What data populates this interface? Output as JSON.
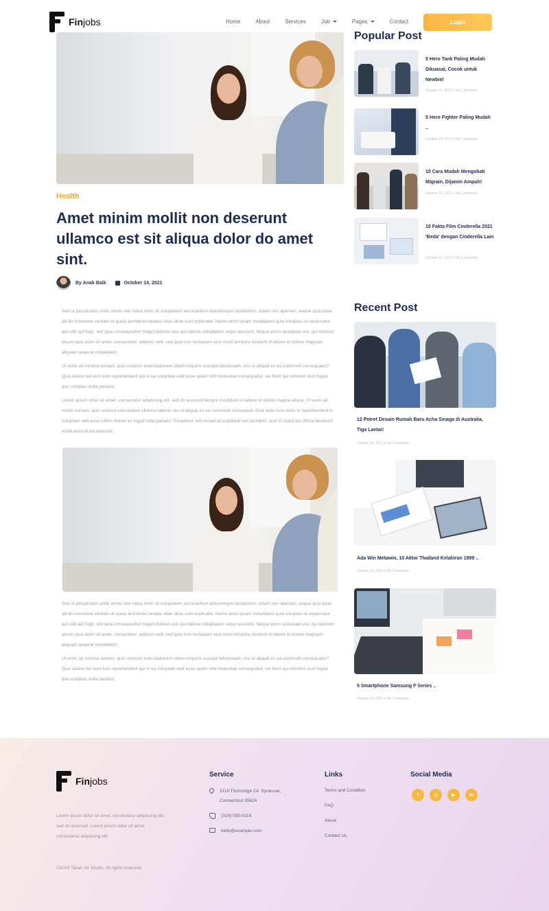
{
  "brand": {
    "name_bold": "Fin",
    "name_rest": "jobs"
  },
  "nav": {
    "items": [
      {
        "label": "Home",
        "dropdown": false
      },
      {
        "label": "About",
        "dropdown": false
      },
      {
        "label": "Services",
        "dropdown": false
      },
      {
        "label": "Job",
        "dropdown": true
      },
      {
        "label": "Pages",
        "dropdown": true
      },
      {
        "label": "Contact",
        "dropdown": false
      }
    ],
    "login_label": "Login"
  },
  "article": {
    "category": "Health",
    "title": "Amet minim mollit non deserunt ullamco est sit aliqua dolor do amet sint.",
    "author": "By Anak Baik",
    "date": "October 14, 2021",
    "paragraphs": [
      "Sed ut perspiciatis unde omnis iste natus error sit voluptatem accusantium doloremque laudantium, totam rem aperiam, eaque ipsa quae ab illo inventore veritatis et quasi architecto beatae vitae dicta sunt explicabo. Nemo enim ipsam voluptatem quia voluptas sit aspernatur aut odit aut fugit, sed quia consequuntur magni dolores eos qui ratione voluptatem sequi nesciunt. Neque porro quisquam est, qui dolorem ipsum quia dolor sit amet, consectetur, adipisci velit, sed quia non numquam eius modi tempora incidunt ut labore et dolore magnam aliquam quaerat voluptatem.",
      "Ut enim ad minima veniam, quis nostrum exercitationem ullam corporis suscipit laboriosam, nisi ut aliquid ex ea commodi consequatur? Quis autem vel eum iure reprehenderit qui in ea voluptate velit esse quam nihil molestiae consequatur, vel illum qui dolorem eum fugiat quo voluptas nulla pariatur.",
      "Lorem ipsum dolor sit amet, consectetur adipiscing elit, sed do eiusmod tempor incididunt ut labore et dolore magna aliqua. Ut enim ad minim veniam, quis nostrud exercitation ullamco laboris nisi ut aliquip ex ea commodo consequat. Duis aute irure dolor in reprehenderit in voluptate velit esse cillum dolore eu fugiat nulla pariatur. Excepteur sint occaecat cupidatat non proident, sunt in culpa qui officia deserunt mollit anim id est laborum.",
      "Sed ut perspiciatis unde omnis iste natus error sit voluptatem accusantium doloremque laudantium, totam rem aperiam, eaque ipsa quae ab illo inventore veritatis et quasi architecto beatae vitae dicta sunt explicabo. Nemo enim ipsam voluptatem quia voluptas sit aspernatur aut odit aut fugit, sed quia consequuntur magni dolores eos qui ratione voluptatem sequi nesciunt. Neque porro quisquam est, qui dolorem ipsum quia dolor sit amet, consectetur, adipisci velit, sed quia non numquam eius modi tempora incidunt ut labore et dolore magnam aliquam quaerat voluptatem.",
      "Ut enim ad minima veniam, quis nostrum exercitationem ullam corporis suscipit laboriosam, nisi ut aliquid ex ea commodi consequatur? Quis autem vel eum iure reprehenderit qui in ea voluptate velit esse quam nihil molestiae consequatur, vel illum qui dolorem eum fugiat quo voluptas nulla pariatur."
    ]
  },
  "popular": {
    "heading": "Popular Post",
    "items": [
      {
        "title": "5 Hero Tank Paling Mudah Dikuasai, Cocok untuk Newbie!",
        "meta": "October 15, 2021 // No Comments"
      },
      {
        "title": "5 Hero Fighter Paling Mudah ..",
        "meta": "October 15, 2021 // No Comments"
      },
      {
        "title": "10 Cara Mudah Mengobati Migrain, Dijamin Ampuh!",
        "meta": "October 15, 2021 // No Comments"
      },
      {
        "title": "10 Fakta Film Cinderella 2021 'Beda' dengan Cinderella Lain",
        "meta": "October 15, 2021 // No Comments"
      }
    ]
  },
  "recent": {
    "heading": "Recent Post",
    "items": [
      {
        "title": "12 Potret Desain Rumah Baru Acha Sinaga di Australia, Tiga Lantai!",
        "meta": "October 15, 2021 // No Comments"
      },
      {
        "title": "Ada Win Metawin, 10 Aktor Thailand Kelahiran 1999 ..",
        "meta": "October 15, 2021 // No Comments"
      },
      {
        "title": "5 Smartphone Samsung F Series ..",
        "meta": "October 15, 2021 // No Comments"
      }
    ]
  },
  "footer": {
    "description": "Lorem ipsum dolor sit amet, consectetur adipiscing elit, sed do eiusmod. Lorem ipsum dolor sit amet, consectetur adipiscing elit.",
    "copyright": "©2020 Tanah Air Studio. All rights reserved.",
    "service_heading": "Service",
    "address": "2118 Thornridge Cir. Syracuse, Connecticut 35624",
    "phone": "(316) 555-0116",
    "email": "hello@example.com",
    "links_heading": "Links",
    "links": [
      "Terms and Condition",
      "FAQ",
      "About",
      "Contact Us"
    ],
    "social_heading": "Social Media",
    "social_icons": [
      "facebook-icon",
      "instagram-icon",
      "youtube-icon",
      "linkedin-icon"
    ]
  },
  "colors": {
    "accent": "#f5a623",
    "heading": "#1f2a55",
    "body_text": "#9aa0ae"
  }
}
